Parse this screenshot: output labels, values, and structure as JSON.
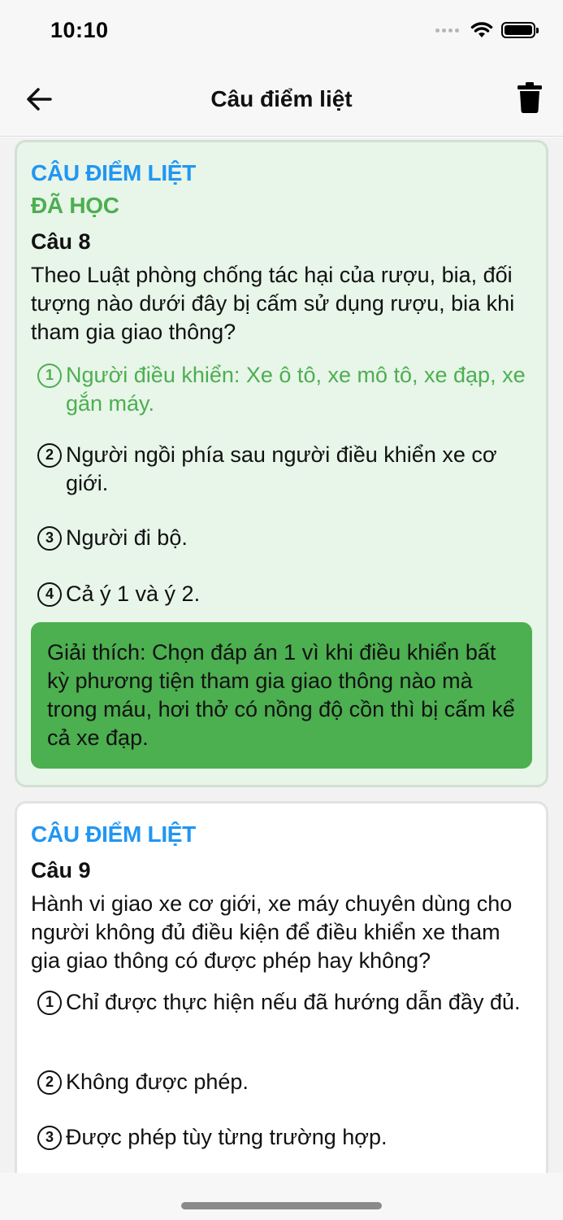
{
  "status_bar": {
    "time": "10:10"
  },
  "nav": {
    "title": "Câu điểm liệt"
  },
  "colors": {
    "accent_blue": "#2196f3",
    "learned_green": "#4caf50",
    "learned_bg": "#e8f5e9"
  },
  "icons": {
    "back": "arrow-left-icon",
    "delete": "trash-icon"
  },
  "cards": [
    {
      "tag": "CÂU ĐIỂM LIỆT",
      "learned_tag": "ĐÃ HỌC",
      "number": "Câu 8",
      "question": "Theo Luật phòng chống tác hại của rượu, bia, đối tượng nào dưới đây bị cấm sử dụng rượu, bia khi tham gia giao thông?",
      "answers": [
        {
          "num": "1",
          "text": "Người điều khiển: Xe ô tô, xe mô tô, xe đạp, xe gắn máy.",
          "correct": true
        },
        {
          "num": "2",
          "text": "Người ngồi phía sau người điều khiển xe cơ giới."
        },
        {
          "num": "3",
          "text": "Người đi bộ."
        },
        {
          "num": "4",
          "text": "Cả ý 1 và ý 2."
        }
      ],
      "explanation": "Giải thích: Chọn đáp án 1 vì khi điều khiển bất kỳ phương tiện tham gia giao thông nào mà trong máu, hơi thở có nồng độ cồn thì bị cấm kể cả xe đạp."
    },
    {
      "tag": "CÂU ĐIỂM LIỆT",
      "number": "Câu 9",
      "question": "Hành vi giao xe cơ giới, xe máy chuyên dùng cho người không đủ điều kiện để điều khiển xe tham gia giao thông có được phép hay không?",
      "answers": [
        {
          "num": "1",
          "text": "Chỉ được thực hiện nếu đã hướng dẫn đầy đủ."
        },
        {
          "num": "2",
          "text": "Không được phép."
        },
        {
          "num": "3",
          "text": "Được phép tùy từng trường hợp."
        }
      ]
    }
  ]
}
